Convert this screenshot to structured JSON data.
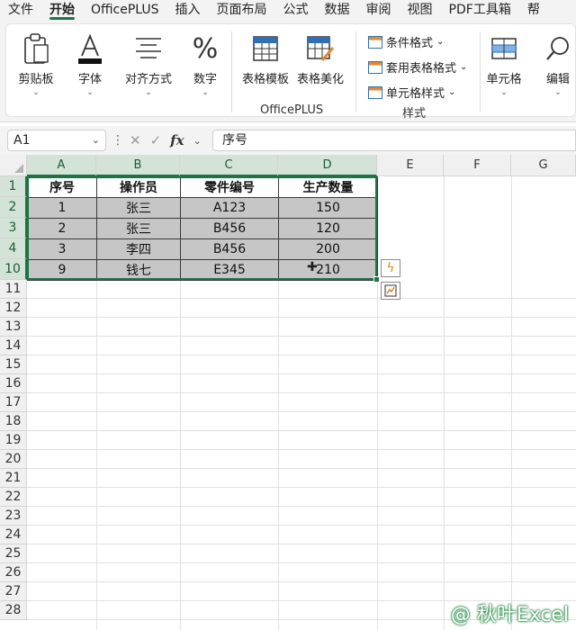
{
  "menu": [
    "文件",
    "开始",
    "OfficePLUS",
    "插入",
    "页面布局",
    "公式",
    "数据",
    "审阅",
    "视图",
    "PDF工具箱",
    "帮"
  ],
  "ribbon": {
    "clipboard": "剪贴板",
    "font": "字体",
    "align": "对齐方式",
    "number": "数字",
    "table_template": "表格模板",
    "table_beautify": "表格美化",
    "officeplus_group": "OfficePLUS",
    "cond_format": "条件格式",
    "table_format": "套用表格格式",
    "cell_style": "单元格样式",
    "styles_group": "样式",
    "cells": "单元格",
    "editing": "编辑"
  },
  "formula_bar": {
    "name_box": "A1",
    "fx": "fx",
    "content": "序号"
  },
  "columns": [
    "A",
    "B",
    "C",
    "D",
    "E",
    "F",
    "G"
  ],
  "row_numbers": [
    "1",
    "2",
    "3",
    "4",
    "10",
    "11",
    "12",
    "13",
    "14",
    "15",
    "16",
    "17",
    "18",
    "19",
    "20",
    "21",
    "22",
    "23",
    "24",
    "25",
    "26",
    "27",
    "28"
  ],
  "table": {
    "headers": [
      "序号",
      "操作员",
      "零件编号",
      "生产数量"
    ],
    "rows": [
      [
        "1",
        "张三",
        "A123",
        "150"
      ],
      [
        "2",
        "张三",
        "B456",
        "120"
      ],
      [
        "3",
        "李四",
        "B456",
        "200"
      ],
      [
        "9",
        "钱七",
        "E345",
        "210"
      ]
    ]
  },
  "watermark": "@ 秋叶Excel",
  "colors": {
    "accent": "#1f7244",
    "selection_fill": "#c6c6c6"
  }
}
